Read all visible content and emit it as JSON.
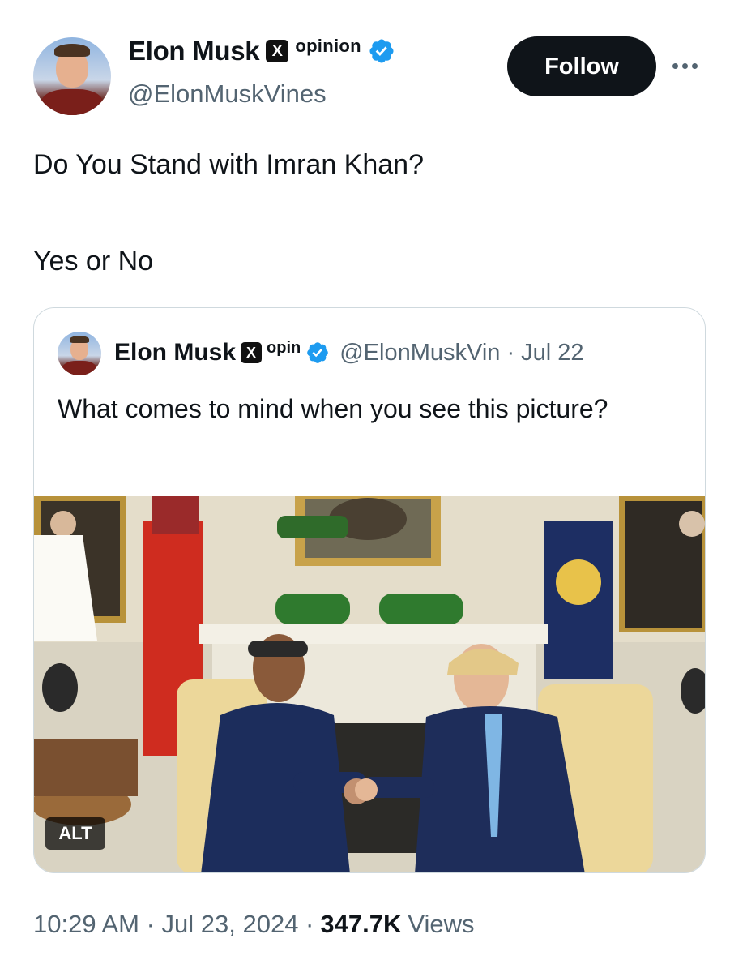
{
  "header": {
    "name": "Elon Musk",
    "x_badge": "X",
    "tag": "opinion",
    "handle": "@ElonMuskVines",
    "follow_label": "Follow",
    "more_icon": "more-horizontal-icon",
    "verified_color": "#1d9bf0"
  },
  "tweet": {
    "line1": "Do You Stand with Imran Khan?",
    "line2": "Yes or No"
  },
  "quoted": {
    "name": "Elon Musk",
    "x_badge": "X",
    "tag": "opin",
    "handle_date": "@ElonMuskVin · Jul 22",
    "text": "What comes to mind when you see this picture?",
    "alt_label": "ALT"
  },
  "meta": {
    "time_date": "10:29 AM · Jul 23, 2024 ·",
    "views_count": "347.7K",
    "views_label": "Views"
  }
}
